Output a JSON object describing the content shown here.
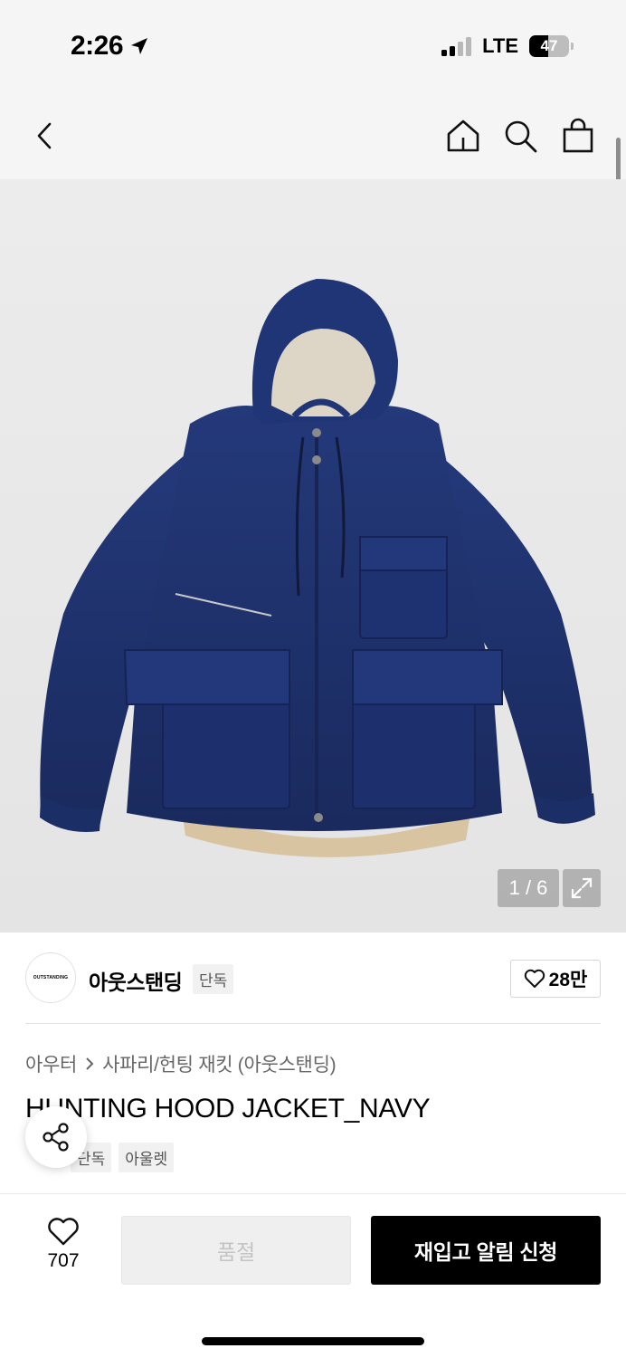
{
  "status_bar": {
    "time": "2:26",
    "network": "LTE",
    "battery_percent": 47,
    "battery_label": "47"
  },
  "nav": {
    "icons": [
      "chevron-left-icon",
      "home-icon",
      "search-icon",
      "shopping-bag-icon"
    ]
  },
  "gallery": {
    "page_counter": "1 / 6",
    "current_index": 1,
    "total": 6,
    "jacket_color": "#1c2f6b",
    "lining_color": "#d8c4a0"
  },
  "brand": {
    "logo_text": "OUTSTANDING",
    "name": "아웃스탠딩",
    "badge": "단독",
    "likes": "28만"
  },
  "product": {
    "breadcrumb": [
      "아우터",
      "사파리/헌팅 재킷 (아웃스탠딩)"
    ],
    "title": "HUNTING HOOD JACKET_NAVY",
    "tags": [
      "단독",
      "아울렛"
    ]
  },
  "bottom": {
    "wish_count": "707",
    "soldout_label": "품절",
    "restock_label": "재입고 알림 신청"
  },
  "colors": {
    "accent": "#000000",
    "nav_bg": "#f5f5f5",
    "disabled_bg": "#efefef",
    "disabled_text": "#c4c4c4"
  }
}
